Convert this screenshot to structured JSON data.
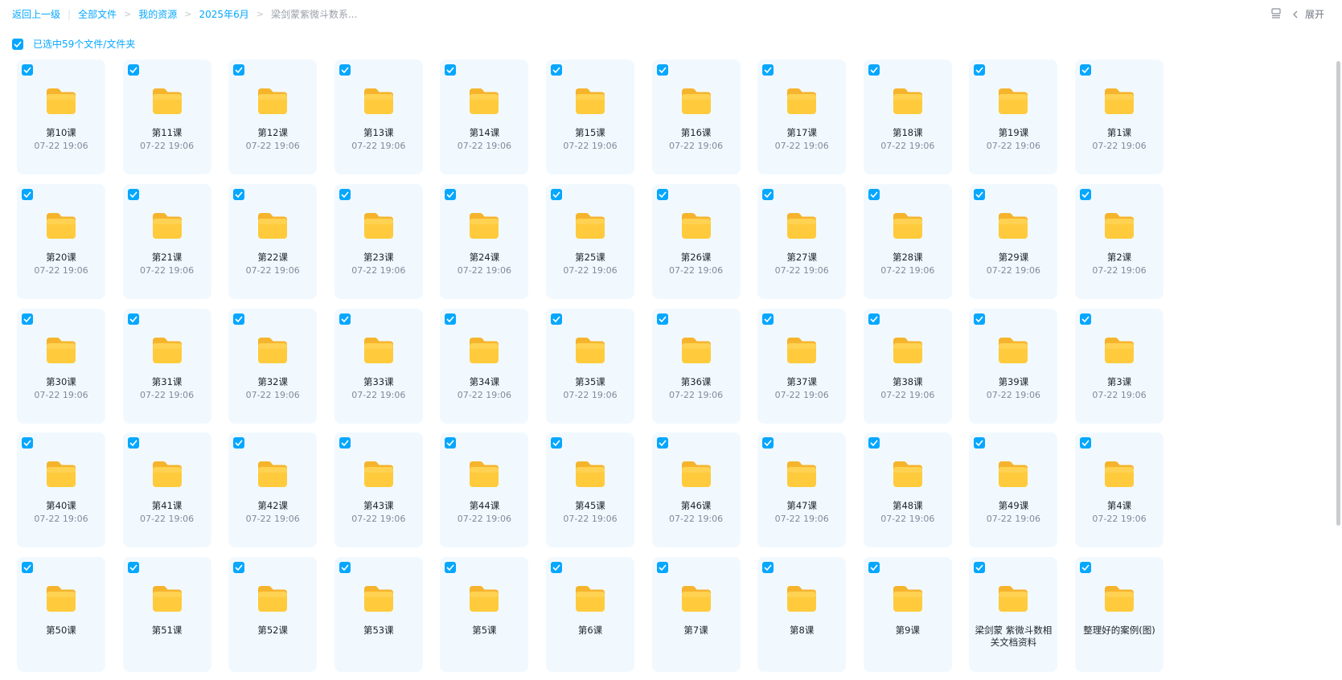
{
  "breadcrumb": {
    "back_label": "返回上一级",
    "items": [
      "全部文件",
      "我的资源",
      "2025年6月"
    ],
    "current": "梁剑蒙紫微斗数系..."
  },
  "toolbar": {
    "expand_label": "展开"
  },
  "selection": {
    "label": "已选中59个文件/文件夹",
    "checked": true
  },
  "files": [
    {
      "name": "第10课",
      "date": "07-22 19:06"
    },
    {
      "name": "第11课",
      "date": "07-22 19:06"
    },
    {
      "name": "第12课",
      "date": "07-22 19:06"
    },
    {
      "name": "第13课",
      "date": "07-22 19:06"
    },
    {
      "name": "第14课",
      "date": "07-22 19:06"
    },
    {
      "name": "第15课",
      "date": "07-22 19:06"
    },
    {
      "name": "第16课",
      "date": "07-22 19:06"
    },
    {
      "name": "第17课",
      "date": "07-22 19:06"
    },
    {
      "name": "第18课",
      "date": "07-22 19:06"
    },
    {
      "name": "第19课",
      "date": "07-22 19:06"
    },
    {
      "name": "第1课",
      "date": "07-22 19:06"
    },
    {
      "name": "第20课",
      "date": "07-22 19:06"
    },
    {
      "name": "第21课",
      "date": "07-22 19:06"
    },
    {
      "name": "第22课",
      "date": "07-22 19:06"
    },
    {
      "name": "第23课",
      "date": "07-22 19:06"
    },
    {
      "name": "第24课",
      "date": "07-22 19:06"
    },
    {
      "name": "第25课",
      "date": "07-22 19:06"
    },
    {
      "name": "第26课",
      "date": "07-22 19:06"
    },
    {
      "name": "第27课",
      "date": "07-22 19:06"
    },
    {
      "name": "第28课",
      "date": "07-22 19:06"
    },
    {
      "name": "第29课",
      "date": "07-22 19:06"
    },
    {
      "name": "第2课",
      "date": "07-22 19:06"
    },
    {
      "name": "第30课",
      "date": "07-22 19:06"
    },
    {
      "name": "第31课",
      "date": "07-22 19:06"
    },
    {
      "name": "第32课",
      "date": "07-22 19:06"
    },
    {
      "name": "第33课",
      "date": "07-22 19:06"
    },
    {
      "name": "第34课",
      "date": "07-22 19:06"
    },
    {
      "name": "第35课",
      "date": "07-22 19:06"
    },
    {
      "name": "第36课",
      "date": "07-22 19:06"
    },
    {
      "name": "第37课",
      "date": "07-22 19:06"
    },
    {
      "name": "第38课",
      "date": "07-22 19:06"
    },
    {
      "name": "第39课",
      "date": "07-22 19:06"
    },
    {
      "name": "第3课",
      "date": "07-22 19:06"
    },
    {
      "name": "第40课",
      "date": "07-22 19:06"
    },
    {
      "name": "第41课",
      "date": "07-22 19:06"
    },
    {
      "name": "第42课",
      "date": "07-22 19:06"
    },
    {
      "name": "第43课",
      "date": "07-22 19:06"
    },
    {
      "name": "第44课",
      "date": "07-22 19:06"
    },
    {
      "name": "第45课",
      "date": "07-22 19:06"
    },
    {
      "name": "第46课",
      "date": "07-22 19:06"
    },
    {
      "name": "第47课",
      "date": "07-22 19:06"
    },
    {
      "name": "第48课",
      "date": "07-22 19:06"
    },
    {
      "name": "第49课",
      "date": "07-22 19:06"
    },
    {
      "name": "第4课",
      "date": "07-22 19:06"
    },
    {
      "name": "第50课",
      "date": ""
    },
    {
      "name": "第51课",
      "date": ""
    },
    {
      "name": "第52课",
      "date": ""
    },
    {
      "name": "第53课",
      "date": ""
    },
    {
      "name": "第5课",
      "date": ""
    },
    {
      "name": "第6课",
      "date": ""
    },
    {
      "name": "第7课",
      "date": ""
    },
    {
      "name": "第8课",
      "date": ""
    },
    {
      "name": "第9课",
      "date": ""
    },
    {
      "name": "梁剑蒙 紫微斗数相关文档资料",
      "date": ""
    },
    {
      "name": "整理好的案例(图)",
      "date": ""
    }
  ],
  "colors": {
    "accent": "#06a7ff",
    "card_bg": "#f1f9ff",
    "folder": "#ffc933"
  },
  "icons": {
    "file_icon": "folder-icon",
    "view_toggle": "list-view-icon",
    "expand_arrow": "chevron-left-icon"
  }
}
